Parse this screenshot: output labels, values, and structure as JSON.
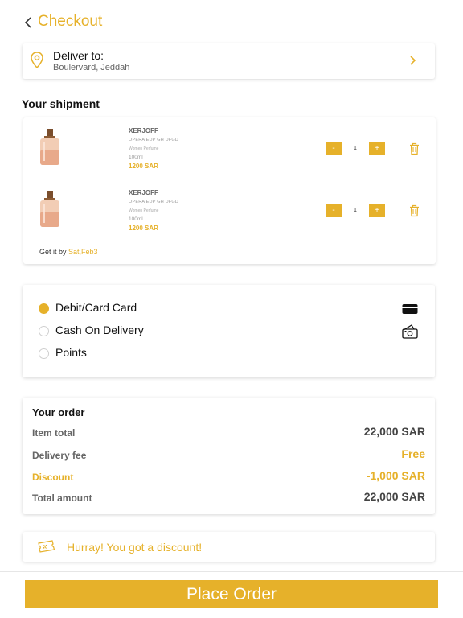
{
  "header": {
    "back_icon": "chevron-left-icon",
    "title": "Checkout"
  },
  "delivery": {
    "icon": "location-pin-icon",
    "label": "Deliver to:",
    "address": "Boulervard, Jeddah",
    "action_icon": "chevron-right-icon"
  },
  "shipment": {
    "title": "Your shipment",
    "items": [
      {
        "brand": "XERJOFF",
        "name": "OPERA EDP GH DFGD",
        "type": "Women Perfume",
        "size": "100ml",
        "price": "1200 SAR",
        "quantity": "1",
        "minus": "-",
        "plus": "+"
      },
      {
        "brand": "XERJOFF",
        "name": "OPERA EDP GH DFGD",
        "type": "Women Perfume",
        "size": "100ml",
        "price": "1200 SAR",
        "quantity": "1",
        "minus": "-",
        "plus": "+"
      }
    ],
    "delivery_prefix": "Get it by ",
    "delivery_date": "Sat,Feb3"
  },
  "payment": {
    "options": [
      {
        "label": "Debit/Card Card",
        "selected": true,
        "icon": "credit-card-icon"
      },
      {
        "label": "Cash On Delivery",
        "selected": false,
        "icon": "cash-icon"
      },
      {
        "label": "Points",
        "selected": false,
        "icon": ""
      }
    ]
  },
  "order": {
    "title": "Your order",
    "rows": [
      {
        "label": "Item total",
        "value": "22,000 SAR"
      },
      {
        "label": "Delivery fee",
        "value": "Free"
      },
      {
        "label": "Discount",
        "value": "-1,000 SAR"
      },
      {
        "label": "Total amount",
        "value": "22,000 SAR"
      }
    ]
  },
  "promo": {
    "icon": "discount-ticket-icon",
    "text": "Hurray! You got a discount!"
  },
  "actions": {
    "place_order": "Place Order"
  },
  "colors": {
    "accent": "#e6b12a",
    "text": "#111111",
    "muted": "#666666"
  }
}
